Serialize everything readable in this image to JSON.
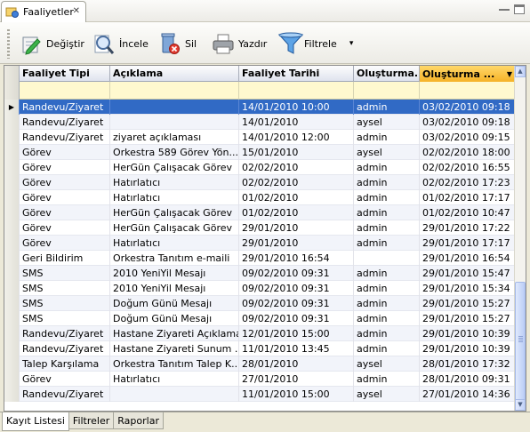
{
  "view_tab": {
    "title": "Faaliyetler",
    "icon": "activity-icon",
    "close": "✕"
  },
  "window_buttons": [
    "minimize-icon",
    "maximize-icon"
  ],
  "toolbar": {
    "edit_label": "Değiştir",
    "inspect_label": "İncele",
    "delete_label": "Sil",
    "print_label": "Yazdır",
    "filter_label": "Filtrele",
    "filter_dropdown": "▾"
  },
  "grid": {
    "columns": [
      "Faaliyet Tipi",
      "Açıklama",
      "Faaliyet Tarihi",
      "Oluşturma...",
      "Oluşturma ..."
    ],
    "sorted_column": 4,
    "sort_direction": "desc",
    "selected_row": 0,
    "selection_color": "#316ac5",
    "rows": [
      [
        "Randevu/Ziyaret",
        "",
        "14/01/2010 10:00",
        "admin",
        "03/02/2010 09:18"
      ],
      [
        "Randevu/Ziyaret",
        "",
        "14/01/2010",
        "aysel",
        "03/02/2010 09:18"
      ],
      [
        "Randevu/Ziyaret",
        "ziyaret açıklaması",
        "14/01/2010 12:00",
        "admin",
        "03/02/2010 09:15"
      ],
      [
        "Görev",
        "Orkestra 589 Görev Yön...",
        "15/01/2010",
        "aysel",
        "02/02/2010 18:00"
      ],
      [
        "Görev",
        "HerGün Çalışacak Görev",
        "02/02/2010",
        "admin",
        "02/02/2010 16:55"
      ],
      [
        "Görev",
        "Hatırlatıcı",
        "02/02/2010",
        "admin",
        "02/02/2010 17:23"
      ],
      [
        "Görev",
        "Hatırlatıcı",
        "01/02/2010",
        "admin",
        "01/02/2010 17:17"
      ],
      [
        "Görev",
        "HerGün Çalışacak Görev",
        "01/02/2010",
        "admin",
        "01/02/2010 10:47"
      ],
      [
        "Görev",
        "HerGün Çalışacak Görev",
        "29/01/2010",
        "admin",
        "29/01/2010 17:22"
      ],
      [
        "Görev",
        "Hatırlatıcı",
        "29/01/2010",
        "admin",
        "29/01/2010 17:17"
      ],
      [
        "Geri Bildirim",
        "Orkestra Tanıtım e-maili",
        "29/01/2010 16:54",
        "",
        "29/01/2010 16:54"
      ],
      [
        "SMS",
        "2010 YeniYil Mesajı",
        "09/02/2010 09:31",
        "admin",
        "29/01/2010 15:47"
      ],
      [
        "SMS",
        "2010 YeniYil Mesajı",
        "09/02/2010 09:31",
        "admin",
        "29/01/2010 15:34"
      ],
      [
        "SMS",
        "Doğum Günü Mesajı",
        "09/02/2010 09:31",
        "admin",
        "29/01/2010 15:27"
      ],
      [
        "SMS",
        "Doğum Günü Mesajı",
        "09/02/2010 09:31",
        "admin",
        "29/01/2010 15:27"
      ],
      [
        "Randevu/Ziyaret",
        "Hastane Ziyareti Açıklaması",
        "12/01/2010 15:00",
        "admin",
        "29/01/2010 10:39"
      ],
      [
        "Randevu/Ziyaret",
        "Hastane Ziyareti Sunum ...",
        "11/01/2010 13:45",
        "admin",
        "29/01/2010 10:39"
      ],
      [
        "Talep Karşılama",
        "Orkestra Tanıtım Talep K...",
        "28/01/2010",
        "aysel",
        "28/01/2010 17:32"
      ],
      [
        "Görev",
        "Hatırlatıcı",
        "27/01/2010",
        "admin",
        "28/01/2010 09:31"
      ],
      [
        "Randevu/Ziyaret",
        "",
        "11/01/2010 15:00",
        "aysel",
        "27/01/2010 14:36"
      ]
    ]
  },
  "bottom_tabs": [
    "Kayıt Listesi",
    "Filtreler",
    "Raporlar"
  ]
}
